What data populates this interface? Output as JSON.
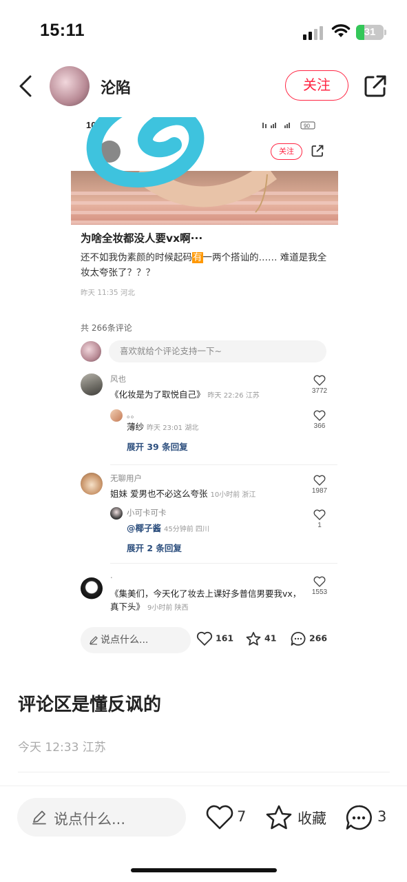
{
  "status_bar": {
    "time": "15:11",
    "battery": "31",
    "battery_level": 0.31
  },
  "header": {
    "author_name": "沦陷",
    "follow_label": "关注"
  },
  "screenshot": {
    "status_time": "10:07",
    "status_icons": "90",
    "follow_label": "关注",
    "post_title": "为啥全妆都没人要vx啊···",
    "post_body_1": "还不如我伪素颜的时候起码",
    "post_body_highlight": "有",
    "post_body_2": "一两个搭讪的…… 难道是我全妆太夸张了？？？",
    "post_meta": "昨天 11:35 河北",
    "comment_count": "共 266条评论",
    "comment_placeholder": "喜欢就给个评论支持一下~",
    "comments": [
      {
        "name": "风也",
        "text": "《化妆是为了取悦自己》",
        "meta": "昨天 22:26 江苏",
        "likes": "3772"
      },
      {
        "name": "。。",
        "text": "薄纱",
        "meta": "昨天 23:01 湖北",
        "likes": "366"
      },
      {
        "expand": "展开 39 条回复"
      },
      {
        "name": "无聊用户",
        "text": "姐妹 爱男也不必这么夸张",
        "meta": "10小时前 浙江",
        "likes": "1987"
      },
      {
        "name": "小可卡可卡",
        "text": "@椰子酱",
        "meta": "45分钟前 四川",
        "likes": "1"
      },
      {
        "expand": "展开 2 条回复"
      },
      {
        "name": ".",
        "text": "《集美们，今天化了妆去上课好多普信男要我vx，真下头》",
        "meta": "9小时前 陕西",
        "likes": "1553"
      }
    ],
    "bottom": {
      "input_placeholder": "说点什么...",
      "likes": "161",
      "collects": "41",
      "comments": "266"
    }
  },
  "note": {
    "title": "评论区是懂反讽的",
    "meta": "今天 12:33 江苏"
  },
  "bottom_bar": {
    "input_placeholder": "说点什么...",
    "likes": "7",
    "collect_label": "收藏",
    "comments": "3"
  },
  "colors": {
    "accent": "#ff2442",
    "link": "#2d4f7e",
    "scribble": "#3ec3de"
  },
  "icons": [
    "back-icon",
    "share-icon",
    "heart-icon",
    "star-icon",
    "comment-icon",
    "pencil-icon",
    "signal-icon",
    "wifi-icon",
    "battery-icon"
  ]
}
